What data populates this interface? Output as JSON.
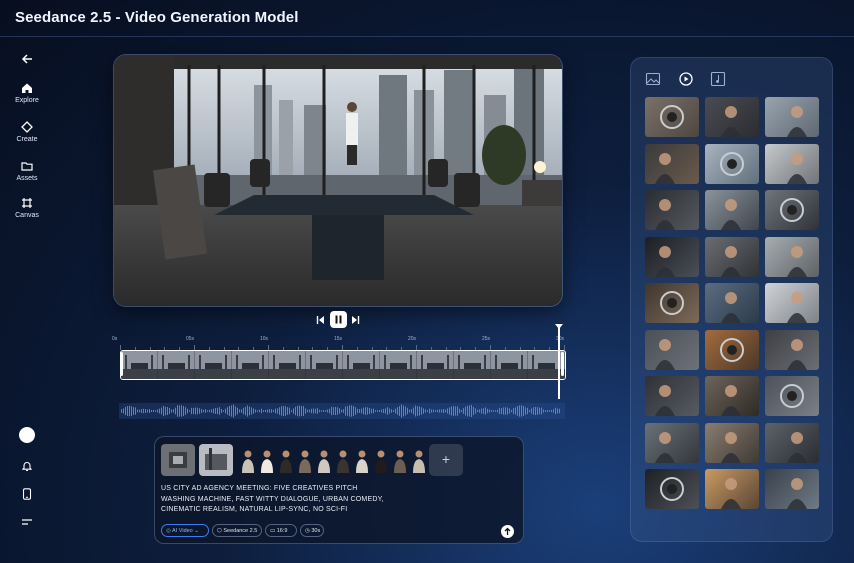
{
  "app": {
    "title": "Seedance 2.5 - Video Generation Model"
  },
  "nav": [
    {
      "label": "Explore",
      "icon": "home-icon"
    },
    {
      "label": "Create",
      "icon": "sparkle-icon"
    },
    {
      "label": "Assets",
      "icon": "folder-icon"
    },
    {
      "label": "Canvas",
      "icon": "canvas-icon"
    }
  ],
  "timeline": {
    "ticks": [
      "0s",
      "05s",
      "10s",
      "15s",
      "20s",
      "25s",
      "30s"
    ],
    "progress_fraction": 1.0
  },
  "prompt": {
    "lines": [
      "US CITY AD AGENCY MEETING: FIVE CREATIVES PITCH",
      "WASHING MACHINE, FAST WITTY DIALOGUE, URBAN COMEDY,",
      "CINEMATIC REALISM, NATURAL LIP-SYNC, NO SCI-FI"
    ],
    "add_label": "+",
    "chips": {
      "mode": "AI Video",
      "model": "Seedance 2.5",
      "ratio": "16:9",
      "duration": "30s"
    }
  },
  "gallery": {
    "tabs": [
      "image-tab-icon",
      "video-tab-icon",
      "audio-tab-icon"
    ],
    "active_tab": 1
  },
  "colors": {
    "accent": "#2a6ef0",
    "panel": "#3c5a8c",
    "background": "#0d1e3d"
  }
}
